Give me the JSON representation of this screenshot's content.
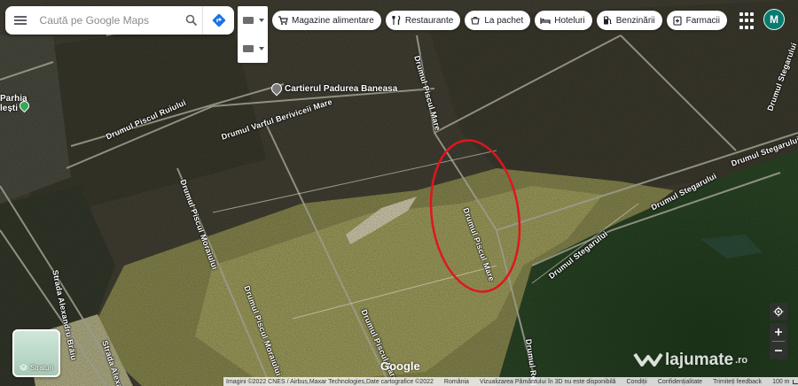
{
  "search": {
    "placeholder": "Caută pe Google Maps"
  },
  "chips": [
    {
      "label": "Magazine alimentare",
      "icon": "cart-icon"
    },
    {
      "label": "Restaurante",
      "icon": "fork-knife-icon"
    },
    {
      "label": "La pachet",
      "icon": "takeout-icon"
    },
    {
      "label": "Hoteluri",
      "icon": "bed-icon"
    },
    {
      "label": "Benzinării",
      "icon": "fuel-icon"
    },
    {
      "label": "Farmacii",
      "icon": "pharmacy-icon"
    }
  ],
  "account": {
    "avatar_letter": "M"
  },
  "map_labels": {
    "place_cartier": "Cartierul Padurea Baneasa",
    "place_left": "Parhia",
    "place_left2": "lești",
    "roads": [
      "Drumul Piscul Ruiului",
      "Drumul Varful Beriviceii Mare",
      "Drumul Piscul Mare",
      "Drumul Stegarului",
      "Drumul Stegarului",
      "Drumul Stegarului",
      "Drumul Piscul Moraiului",
      "Drumul Piscul Moraiului",
      "Drumul Piscul Mare",
      "Drumul Piscul Mare",
      "Drumul Stegarului",
      "Strada Alexandru Brăiu",
      "Strada Alexandr",
      "Drumul Regin"
    ]
  },
  "layers": {
    "label": "Straturi"
  },
  "branding": {
    "google": "Google",
    "watermark": "lajumate",
    "watermark_tld": ".ro"
  },
  "footer": {
    "imagery": "Imagini ©2022 CNES / Airbus,Maxar Technologies,Date cartografice ©2022",
    "country": "România",
    "view3d": "Vizualizarea Pământului în 3D nu este disponibilă",
    "terms": "Condiții",
    "privacy": "Confidențialitate",
    "feedback": "Trimiteți feedback",
    "scale": "100 m"
  },
  "colors": {
    "highlight_ellipse": "#e0161d",
    "avatar": "#0b7a70",
    "directions": "#1a73e8"
  }
}
